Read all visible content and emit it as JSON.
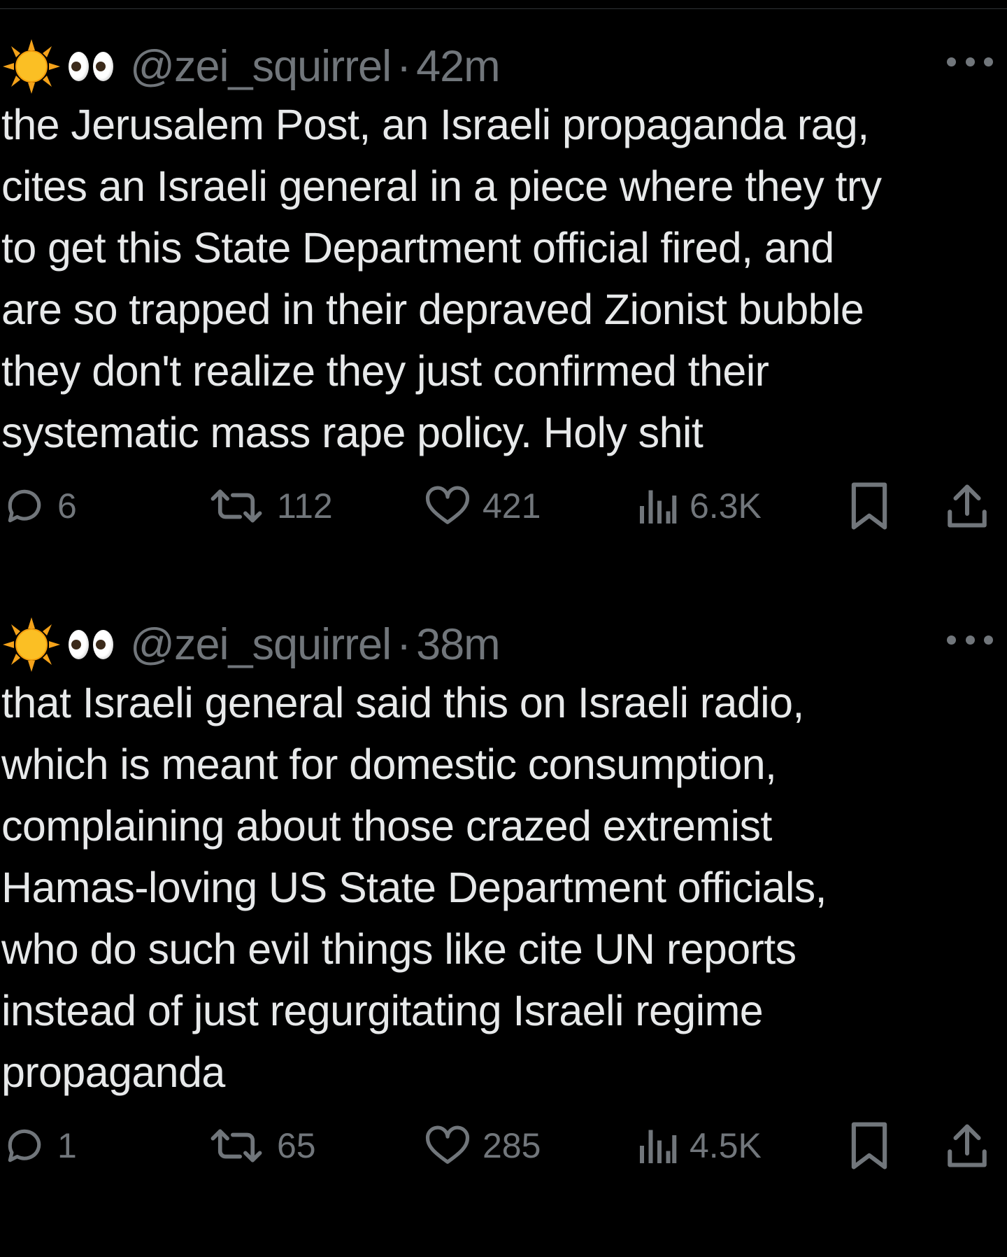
{
  "tweets": [
    {
      "handle": "@zei_squirrel",
      "separator": "·",
      "time": "42m",
      "text": "the Jerusalem Post, an Israeli propaganda rag,\ncites an Israeli general in a piece where they try\nto get this State Department official fired, and\nare so trapped in their depraved Zionist bubble\nthey don't realize they just confirmed their\nsystematic mass rape policy. Holy shit",
      "replies": "6",
      "reposts": "112",
      "likes": "421",
      "views": "6.3K"
    },
    {
      "handle": "@zei_squirrel",
      "separator": "·",
      "time": "38m",
      "text": "that Israeli general said this on Israeli radio,\nwhich is meant for domestic consumption,\ncomplaining about those crazed extremist\nHamas-loving US State Department officials,\nwho do such evil things like cite UN reports\ninstead of just regurgitating Israeli regime\npropaganda",
      "replies": "1",
      "reposts": "65",
      "likes": "285",
      "views": "4.5K"
    }
  ],
  "icons": {
    "display_name": [
      "sun-emoji",
      "eyes-emoji"
    ],
    "more": "more-horizontal-icon",
    "reply": "reply-bubble-icon",
    "repost": "repost-arrows-icon",
    "like": "heart-icon",
    "views": "views-bar-chart-icon",
    "bookmark": "bookmark-icon",
    "share": "share-upload-icon"
  },
  "colors": {
    "background": "#000000",
    "text": "#e7e9ea",
    "muted": "#71767b",
    "divider": "#2f3336"
  }
}
